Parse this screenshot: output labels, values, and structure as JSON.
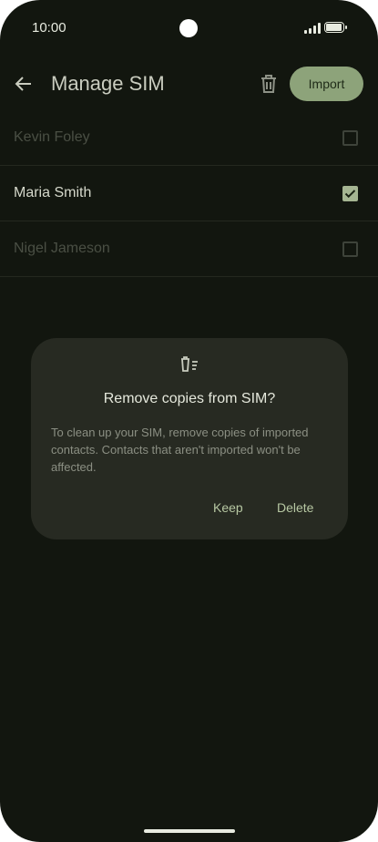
{
  "status_bar": {
    "time": "10:00"
  },
  "app_bar": {
    "title": "Manage SIM",
    "import_label": "Import"
  },
  "contacts": [
    {
      "name": "Kevin Foley",
      "checked": false
    },
    {
      "name": "Maria Smith",
      "checked": true
    },
    {
      "name": "Nigel Jameson",
      "checked": false
    }
  ],
  "dialog": {
    "title": "Remove copies from SIM?",
    "body": "To clean up your SIM, remove copies of imported contacts. Contacts that aren't imported won't be affected.",
    "keep_label": "Keep",
    "delete_label": "Delete"
  },
  "colors": {
    "background": "#12160f",
    "accent": "#8da37a",
    "dialog_surface": "#272a22"
  }
}
